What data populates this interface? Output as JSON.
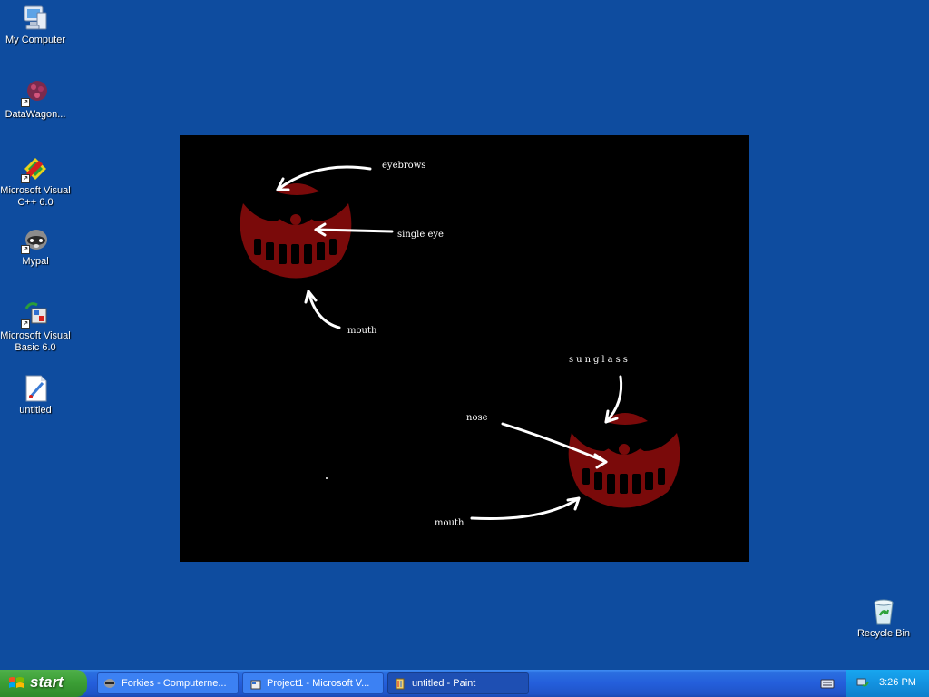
{
  "desktop": {
    "background_color": "#0e4c9f",
    "icons": [
      {
        "label": "My Computer",
        "icon": "computer-icon"
      },
      {
        "label": "DataWagon...",
        "icon": "datawagon-icon"
      },
      {
        "label": "Microsoft Visual C++ 6.0",
        "icon": "visual-cpp-icon"
      },
      {
        "label": "Mypal",
        "icon": "mypal-raccoon-icon"
      },
      {
        "label": "Microsoft Visual Basic 6.0",
        "icon": "visual-basic-icon"
      },
      {
        "label": "untitled",
        "icon": "paint-file-icon"
      },
      {
        "label": "Recycle Bin",
        "icon": "recycle-bin-icon"
      }
    ]
  },
  "wallpaper": {
    "background_color": "#000000",
    "face_color": "#7a0a0a",
    "annotations": {
      "eyebrows": "eyebrows",
      "single_eye": "single eye",
      "mouth_top": "mouth",
      "sunglass": "sunglass",
      "nose": "nose",
      "mouth_bottom": "mouth"
    }
  },
  "taskbar": {
    "start_label": "start",
    "tasks": [
      {
        "label": "Forkies - Computerne...",
        "icon": "raccoon-icon",
        "active": false
      },
      {
        "label": "Project1 - Microsoft V...",
        "icon": "vb-project-icon",
        "active": false
      },
      {
        "label": "untitled - Paint",
        "icon": "paint-icon",
        "active": true
      }
    ],
    "clock": "3:26 PM",
    "colors": {
      "taskbar": "#245edb",
      "start": "#3c9f36",
      "tray": "#1392e0"
    }
  }
}
